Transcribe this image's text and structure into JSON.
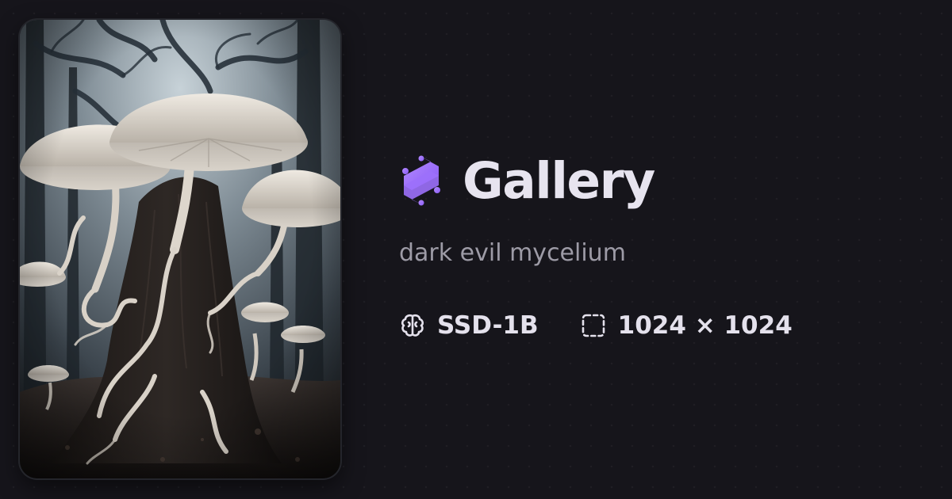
{
  "brand": {
    "title": "Gallery",
    "logo_icon": "stack-layers-icon",
    "accent_color": "#9b6bff"
  },
  "artwork": {
    "prompt": "dark evil mycelium"
  },
  "meta": {
    "model": {
      "icon": "brain-icon",
      "label": "SSD-1B"
    },
    "dimensions": {
      "icon": "dashed-frame-icon",
      "label": "1024 × 1024"
    }
  },
  "colors": {
    "background": "#16151b",
    "title_text": "#e7e4ef",
    "secondary_text": "#9d9ba6"
  }
}
